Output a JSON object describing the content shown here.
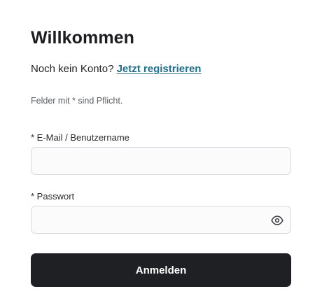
{
  "header": {
    "title": "Willkommen"
  },
  "signup": {
    "prompt": "Noch kein Konto? ",
    "link_label": "Jetzt registrieren"
  },
  "form": {
    "required_note": "Felder mit * sind Pflicht.",
    "email": {
      "label": "* E-Mail / Benutzername",
      "value": "",
      "placeholder": ""
    },
    "password": {
      "label": "* Passwort",
      "value": "",
      "placeholder": "",
      "toggle_icon": "eye-icon"
    },
    "submit_label": "Anmelden"
  },
  "colors": {
    "link": "#1f6f8b",
    "button_bg": "#1f2024",
    "field_border": "#d9d9dd"
  }
}
